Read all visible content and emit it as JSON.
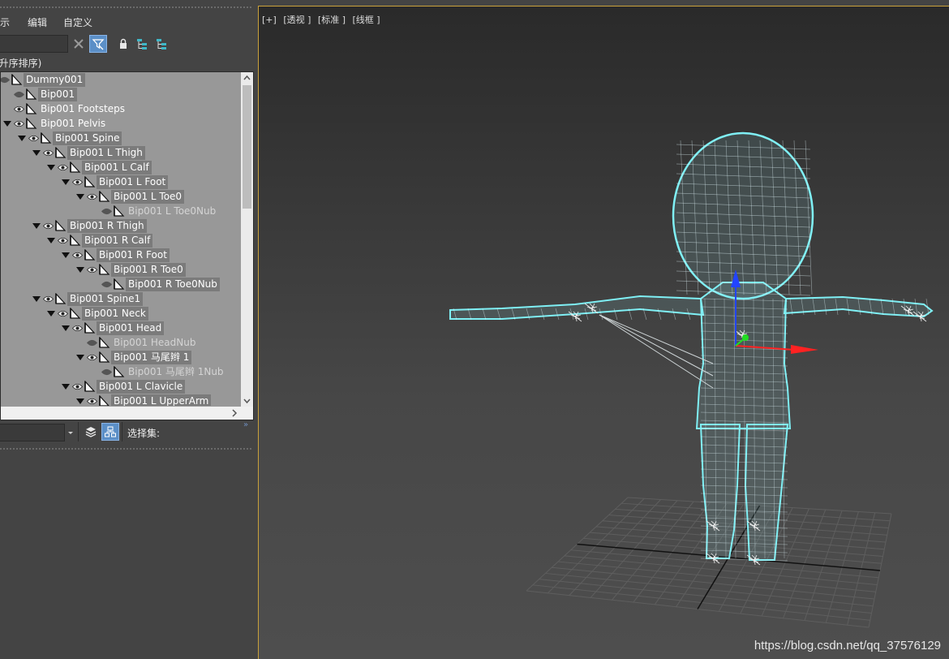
{
  "menu": {
    "display": "显示",
    "edit": "编辑",
    "customize": "自定义"
  },
  "scene_explorer": {
    "sort_header": "(升序排序)",
    "tree": [
      {
        "label": "Dummy001",
        "level": 0,
        "expanded": true,
        "visible": false,
        "selected": true
      },
      {
        "label": "Bip001",
        "level": 1,
        "expanded": null,
        "visible": false,
        "selected": true
      },
      {
        "label": "Bip001 Footsteps",
        "level": 1,
        "expanded": null,
        "visible": true,
        "selected": false
      },
      {
        "label": "Bip001 Pelvis",
        "level": 1,
        "expanded": true,
        "visible": true,
        "selected": false
      },
      {
        "label": "Bip001 Spine",
        "level": 2,
        "expanded": true,
        "visible": true,
        "selected": true
      },
      {
        "label": "Bip001 L Thigh",
        "level": 3,
        "expanded": true,
        "visible": true,
        "selected": true
      },
      {
        "label": "Bip001 L Calf",
        "level": 4,
        "expanded": true,
        "visible": true,
        "selected": true
      },
      {
        "label": "Bip001 L Foot",
        "level": 5,
        "expanded": true,
        "visible": true,
        "selected": true
      },
      {
        "label": "Bip001 L Toe0",
        "level": 6,
        "expanded": true,
        "visible": true,
        "selected": true
      },
      {
        "label": "Bip001 L Toe0Nub",
        "level": 7,
        "expanded": null,
        "visible": false,
        "selected": false
      },
      {
        "label": "Bip001 R Thigh",
        "level": 3,
        "expanded": true,
        "visible": true,
        "selected": true
      },
      {
        "label": "Bip001 R Calf",
        "level": 4,
        "expanded": true,
        "visible": true,
        "selected": true
      },
      {
        "label": "Bip001 R Foot",
        "level": 5,
        "expanded": true,
        "visible": true,
        "selected": true
      },
      {
        "label": "Bip001 R Toe0",
        "level": 6,
        "expanded": true,
        "visible": true,
        "selected": true
      },
      {
        "label": "Bip001 R Toe0Nub",
        "level": 7,
        "expanded": null,
        "visible": false,
        "selected": true
      },
      {
        "label": "Bip001 Spine1",
        "level": 3,
        "expanded": true,
        "visible": true,
        "selected": true
      },
      {
        "label": "Bip001 Neck",
        "level": 4,
        "expanded": true,
        "visible": true,
        "selected": true
      },
      {
        "label": "Bip001 Head",
        "level": 5,
        "expanded": true,
        "visible": true,
        "selected": true
      },
      {
        "label": "Bip001 HeadNub",
        "level": 6,
        "expanded": null,
        "visible": false,
        "selected": false
      },
      {
        "label": "Bip001 马尾辫 1",
        "level": 6,
        "expanded": true,
        "visible": true,
        "selected": true
      },
      {
        "label": "Bip001 马尾辫 1Nub",
        "level": 7,
        "expanded": null,
        "visible": false,
        "selected": false
      },
      {
        "label": "Bip001 L Clavicle",
        "level": 5,
        "expanded": true,
        "visible": true,
        "selected": true
      },
      {
        "label": "Bip001 L UpperArm",
        "level": 6,
        "expanded": true,
        "visible": true,
        "selected": true
      }
    ],
    "selection_set_label": "选择集:"
  },
  "viewport": {
    "labels": [
      "[+]",
      "[透视 ]",
      "[标准 ]",
      "[线框 ]"
    ]
  },
  "watermark": "https://blog.csdn.net/qq_37576129",
  "colors": {
    "wireframe": "#7ff0f5",
    "gizmo_x": "#ff2222",
    "gizmo_y": "#22dd22",
    "gizmo_z": "#2244ff",
    "viewport_border": "#c9a13b"
  }
}
